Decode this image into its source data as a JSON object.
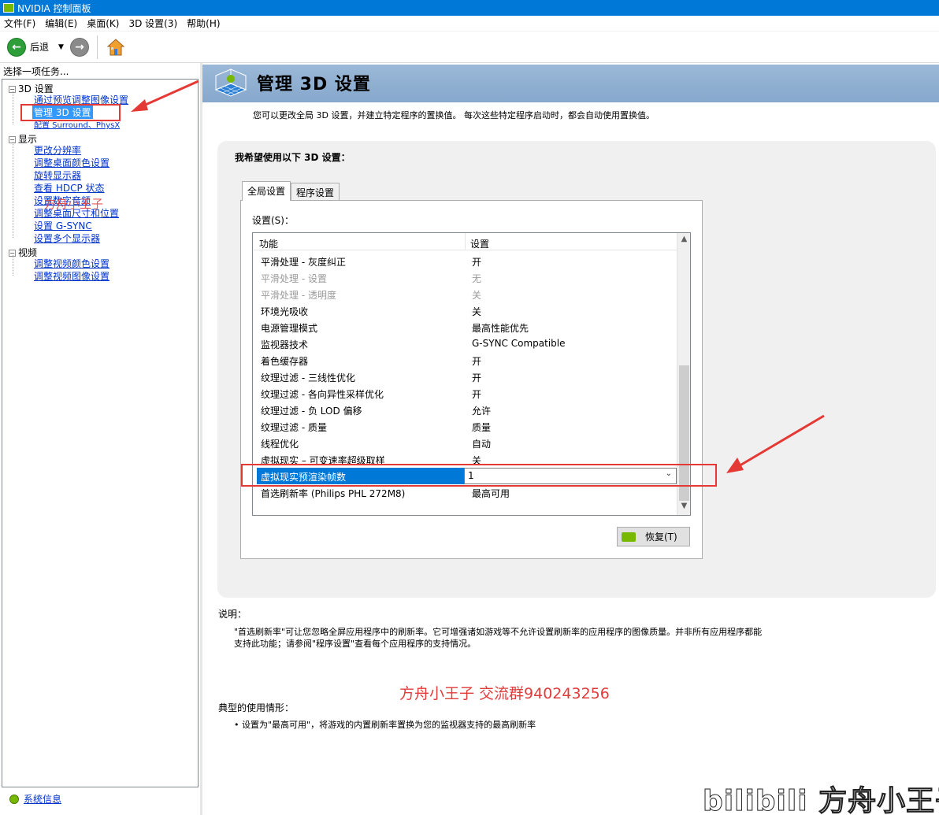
{
  "window": {
    "title": "NVIDIA 控制面板"
  },
  "menu": {
    "items": [
      "文件(F)",
      "编辑(E)",
      "桌面(K)",
      "3D 设置(3)",
      "帮助(H)"
    ]
  },
  "toolbar": {
    "back_label": "后退"
  },
  "left": {
    "header": "选择一项任务...",
    "groups": [
      {
        "label": "3D 设置",
        "children": [
          "通过预览调整图像设置",
          "管理 3D 设置",
          "配置 Surround、PhysX"
        ]
      },
      {
        "label": "显示",
        "children": [
          "更改分辨率",
          "调整桌面颜色设置",
          "旋转显示器",
          "查看 HDCP 状态",
          "设置数字音频",
          "调整桌面尺寸和位置",
          "设置 G-SYNC",
          "设置多个显示器"
        ]
      },
      {
        "label": "视频",
        "children": [
          "调整视频颜色设置",
          "调整视频图像设置"
        ]
      }
    ],
    "system_info": "系统信息"
  },
  "main": {
    "title": "管理 3D 设置",
    "subtitle": "您可以更改全局 3D 设置，并建立特定程序的置换值。 每次这些特定程序启动时，都会自动使用置换值。",
    "group_title": "我希望使用以下 3D 设置：",
    "tabs": [
      "全局设置",
      "程序设置"
    ],
    "settings_label": "设置(S)：",
    "columns": [
      "功能",
      "设置"
    ],
    "rows": [
      {
        "feature": "平滑处理 - 灰度纠正",
        "value": "开"
      },
      {
        "feature": "平滑处理 - 设置",
        "value": "无"
      },
      {
        "feature": "平滑处理 - 透明度",
        "value": "关"
      },
      {
        "feature": "环境光吸收",
        "value": "关"
      },
      {
        "feature": "电源管理模式",
        "value": "最高性能优先"
      },
      {
        "feature": "监视器技术",
        "value": "G-SYNC Compatible"
      },
      {
        "feature": "着色缓存器",
        "value": "开"
      },
      {
        "feature": "纹理过滤 - 三线性优化",
        "value": "开"
      },
      {
        "feature": "纹理过滤 - 各向异性采样优化",
        "value": "开"
      },
      {
        "feature": "纹理过滤 - 负 LOD 偏移",
        "value": "允许"
      },
      {
        "feature": "纹理过滤 - 质量",
        "value": "质量"
      },
      {
        "feature": "线程优化",
        "value": "自动"
      },
      {
        "feature": "虚拟现实 – 可变速率超级取样",
        "value": "关"
      },
      {
        "feature": "虚拟现实预渲染帧数",
        "value": "1"
      },
      {
        "feature": "首选刷新率 (Philips PHL 272M8)",
        "value": "最高可用"
      }
    ],
    "restore_label": "恢复(T)"
  },
  "description": {
    "heading": "说明：",
    "text": "\"首选刷新率\"可让您忽略全屏应用程序中的刷新率。它可增强诸如游戏等不允许设置刷新率的应用程序的图像质量。并非所有应用程序都能支持此功能；请参阅\"程序设置\"查看每个应用程序的支持情况。",
    "usage_heading": "典型的使用情形：",
    "usage_item": "• 设置为\"最高可用\"，将游戏的内置刷新率置换为您的监视器支持的最高刷新率"
  },
  "annotations": {
    "watermark_center": "方舟小王子  交流群940243256",
    "watermark_left": "方舟小王子",
    "footer_watermark": "bilibili 方舟小王子"
  },
  "colors": {
    "accent": "#0078d7",
    "nvidia_green": "#76b900",
    "annotation_red": "#e53935"
  }
}
